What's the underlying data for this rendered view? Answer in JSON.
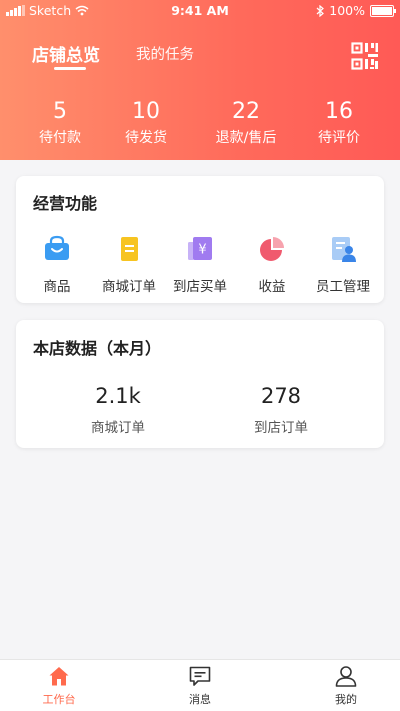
{
  "status_bar": {
    "carrier": "Sketch",
    "time": "9:41 AM",
    "battery": "100%"
  },
  "header": {
    "tabs": [
      {
        "label": "店铺总览",
        "active": true
      },
      {
        "label": "我的任务",
        "active": false
      }
    ],
    "qr_icon": "qr-code-icon",
    "stats": [
      {
        "value": "5",
        "label": "待付款"
      },
      {
        "value": "10",
        "label": "待发货"
      },
      {
        "value": "22",
        "label": "退款/售后"
      },
      {
        "value": "16",
        "label": "待评价"
      }
    ]
  },
  "functions": {
    "title": "经营功能",
    "items": [
      {
        "label": "商品",
        "icon": "shopping-bag-icon",
        "color": "#3a9cf2"
      },
      {
        "label": "商城订单",
        "icon": "order-list-icon",
        "color": "#f7c421"
      },
      {
        "label": "到店买单",
        "icon": "yuan-payment-icon",
        "color": "#a07bf0"
      },
      {
        "label": "收益",
        "icon": "pie-chart-icon",
        "color": "#f05a6e"
      },
      {
        "label": "员工管理",
        "icon": "staff-icon",
        "color": "#5a9ff0"
      }
    ]
  },
  "store_data": {
    "title": "本店数据（本月）",
    "items": [
      {
        "value": "2.1k",
        "label": "商城订单"
      },
      {
        "value": "278",
        "label": "到店订单"
      }
    ]
  },
  "tabbar": {
    "items": [
      {
        "label": "工作台",
        "icon": "home-icon",
        "active": true
      },
      {
        "label": "消息",
        "icon": "message-icon",
        "active": false
      },
      {
        "label": "我的",
        "icon": "user-icon",
        "active": false
      }
    ],
    "active_color": "#ff6a4d"
  }
}
